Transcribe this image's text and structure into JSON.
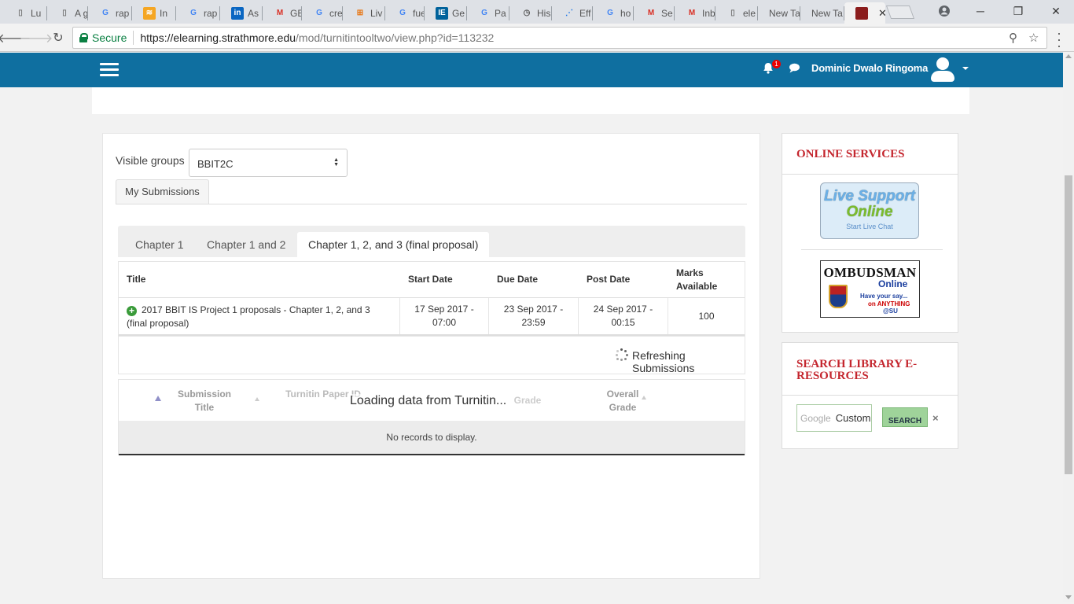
{
  "browser": {
    "tabs": [
      {
        "label": "Lu",
        "icon": "doc-icon"
      },
      {
        "label": "A g",
        "icon": "doc-icon"
      },
      {
        "label": "rap",
        "icon": "google-icon"
      },
      {
        "label": "In",
        "icon": "rss-icon"
      },
      {
        "label": "rap",
        "icon": "google-icon"
      },
      {
        "label": "As",
        "icon": "linkedin-icon"
      },
      {
        "label": "GE",
        "icon": "gmail-icon"
      },
      {
        "label": "cre",
        "icon": "google-icon"
      },
      {
        "label": "Liv",
        "icon": "grid-icon"
      },
      {
        "label": "fue",
        "icon": "google-icon"
      },
      {
        "label": "Ge",
        "icon": "ieee-icon"
      },
      {
        "label": "Pa",
        "icon": "google-icon"
      },
      {
        "label": "His",
        "icon": "history-icon"
      },
      {
        "label": "Eff",
        "icon": "dots-icon"
      },
      {
        "label": "ho",
        "icon": "google-icon"
      },
      {
        "label": "Se",
        "icon": "gmail-icon"
      },
      {
        "label": "Inb",
        "icon": "gmail-icon"
      },
      {
        "label": "ele",
        "icon": "doc-icon"
      },
      {
        "label": "New Ta",
        "icon": ""
      },
      {
        "label": "New Ta",
        "icon": ""
      },
      {
        "label": "",
        "icon": "crest-icon"
      }
    ],
    "secure_label": "Secure",
    "url_host": "https://elearning.strathmore.edu",
    "url_path": "/mod/turnitintooltwo/view.php?id=113232"
  },
  "header": {
    "notification_count": "1",
    "user_name": "Dominic Dwalo Ringoma"
  },
  "main": {
    "visible_groups_label": "Visible groups",
    "group_selected": "BBIT2C",
    "my_submissions_tab": "My Submissions",
    "part_tabs": [
      "Chapter 1",
      "Chapter 1 and 2",
      "Chapter 1, 2, and 3 (final proposal)"
    ],
    "parts_table": {
      "headers": [
        "Title",
        "Start Date",
        "Due Date",
        "Post Date",
        "Marks Available"
      ],
      "row": {
        "title": "2017 BBIT IS Project 1 proposals - Chapter 1, 2, and 3 (final proposal)",
        "start_date": "17 Sep 2017 - 07:00",
        "due_date": "23 Sep 2017 - 23:59",
        "post_date": "24 Sep 2017 - 00:15",
        "marks": "100"
      }
    },
    "refreshing_text": "Refreshing Submissions",
    "submissions_table": {
      "headers": {
        "submission_title": "Submission Title",
        "turnitin_paper_id": "Turnitin Paper ID",
        "grade": "Grade",
        "overall_grade": "Overall Grade"
      },
      "loading_text": "Loading data from Turnitin...",
      "empty_text": "No records to display."
    }
  },
  "sidebar": {
    "online_services_title": "ONLINE SERVICES",
    "live_support": {
      "line1": "Live Support",
      "line2": "Online",
      "line3": "Start Live Chat"
    },
    "ombudsman": {
      "line1": "OMBUDSMAN",
      "line2": "Online",
      "line3": "Have your say...",
      "line4": "on ANYTHING",
      "line5": "@SU"
    },
    "library_title": "SEARCH LIBRARY E-RESOURCES",
    "search_brand": "Google",
    "search_placeholder": "Custom",
    "search_button": "SEARCH",
    "clear_label": "×"
  },
  "colors": {
    "header_blue": "#0f6fa0",
    "block_title_red": "#c4262e",
    "secure_green": "#0b8043"
  }
}
